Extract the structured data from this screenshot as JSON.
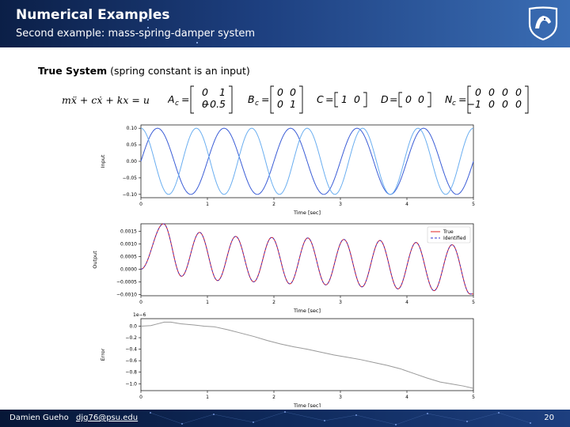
{
  "header": {
    "title": "Numerical Examples",
    "subtitle": "Second example: mass-spring-damper system",
    "logo": "penn-state-nittany-lion-shield"
  },
  "section": {
    "title_bold": "True System",
    "title_rest": "(spring constant is an input)"
  },
  "equations": {
    "ode": "mẍ + cẋ + kx = u",
    "Ac_label": "A",
    "Ac_sub": "c",
    "Ac": [
      [
        "0",
        "1"
      ],
      [
        "0",
        "−0.5"
      ]
    ],
    "Bc_label": "B",
    "Bc_sub": "c",
    "Bc": [
      [
        "0",
        "0"
      ],
      [
        "0",
        "1"
      ]
    ],
    "C_label": "C",
    "C": [
      [
        "1",
        "0"
      ]
    ],
    "D_label": "D",
    "D": [
      [
        "0",
        "0"
      ]
    ],
    "Nc_label": "N",
    "Nc_sub": "c",
    "Nc": [
      [
        "0",
        "0",
        "0",
        "0"
      ],
      [
        "−1",
        "0",
        "0",
        "0"
      ]
    ]
  },
  "footer": {
    "author": "Damien Gueho",
    "email": "djg76@psu.edu",
    "page": "20"
  },
  "chart_data": [
    {
      "type": "line",
      "ylabel": "Input",
      "xlabel": "Time [sec]",
      "xlim": [
        0,
        5
      ],
      "ylim": [
        -0.11,
        0.11
      ],
      "xticks": [
        "0",
        "1",
        "2",
        "3",
        "4",
        "5"
      ],
      "yticks": [
        "0.10",
        "0.05",
        "0.00",
        "−0.05",
        "−0.10"
      ],
      "ytick_values": [
        0.1,
        0.05,
        0.0,
        -0.05,
        -0.1
      ],
      "series": [
        {
          "color": "#3a5cd6",
          "amplitude": 0.1,
          "frequency": 1.0,
          "phase": 0.0
        },
        {
          "color": "#6aaef0",
          "amplitude": 0.1,
          "frequency": 1.2,
          "phase": 1.5708
        }
      ]
    },
    {
      "type": "line",
      "ylabel": "Output",
      "xlabel": "Time [sec]",
      "xlim": [
        0,
        5
      ],
      "ylim": [
        -0.00105,
        0.0018
      ],
      "xticks": [
        "0",
        "1",
        "2",
        "3",
        "4",
        "5"
      ],
      "yticks": [
        "0.0015",
        "0.0010",
        "0.0005",
        "0.0000",
        "−0.0005",
        "−0.0010"
      ],
      "ytick_values": [
        0.0015,
        0.001,
        0.0005,
        0.0,
        -0.0005,
        -0.001
      ],
      "legend": {
        "position": "top-right"
      },
      "series": [
        {
          "name": "True",
          "color": "#e02020",
          "style": "solid"
        },
        {
          "name": "Identified",
          "color": "#3030d0",
          "style": "dashed"
        }
      ],
      "x_peaks": [
        0.33,
        0.98,
        1.59,
        2.18,
        2.76,
        3.33,
        3.9,
        4.47,
        5.0
      ],
      "y_peaks": [
        0.0018,
        -0.00028,
        0.00146,
        -0.00045,
        0.0013,
        -0.0005,
        0.00126,
        -0.00058,
        0.00124,
        -0.00062,
        0.00118,
        -0.0007,
        0.00114,
        -0.00078,
        0.00106,
        -0.00085,
        0.00097,
        -0.00098
      ]
    },
    {
      "type": "line",
      "ylabel": "Error",
      "xlabel": "Time [sec]",
      "offset_label": "1e−6",
      "xlim": [
        0,
        5
      ],
      "ylim": [
        -1.12,
        0.13
      ],
      "xticks": [
        "0",
        "1",
        "2",
        "3",
        "4",
        "5"
      ],
      "yticks": [
        "0.0",
        "−0.2",
        "−0.4",
        "−0.6",
        "−0.8",
        "−1.0"
      ],
      "ytick_values": [
        0.0,
        -0.2,
        -0.4,
        -0.6,
        -0.8,
        -1.0
      ],
      "series": [
        {
          "color": "#999999",
          "x": [
            0.0,
            0.15,
            0.25,
            0.35,
            0.45,
            0.6,
            0.8,
            0.95,
            1.1,
            1.3,
            1.5,
            1.7,
            1.9,
            2.1,
            2.3,
            2.5,
            2.7,
            2.9,
            3.1,
            3.3,
            3.5,
            3.7,
            3.9,
            4.1,
            4.3,
            4.5,
            4.7,
            4.85,
            5.0
          ],
          "y": [
            0.0,
            0.01,
            0.04,
            0.07,
            0.07,
            0.04,
            0.02,
            0.0,
            -0.01,
            -0.06,
            -0.12,
            -0.18,
            -0.25,
            -0.31,
            -0.36,
            -0.4,
            -0.45,
            -0.5,
            -0.54,
            -0.58,
            -0.63,
            -0.68,
            -0.74,
            -0.82,
            -0.9,
            -0.97,
            -1.01,
            -1.04,
            -1.08
          ]
        }
      ]
    }
  ]
}
